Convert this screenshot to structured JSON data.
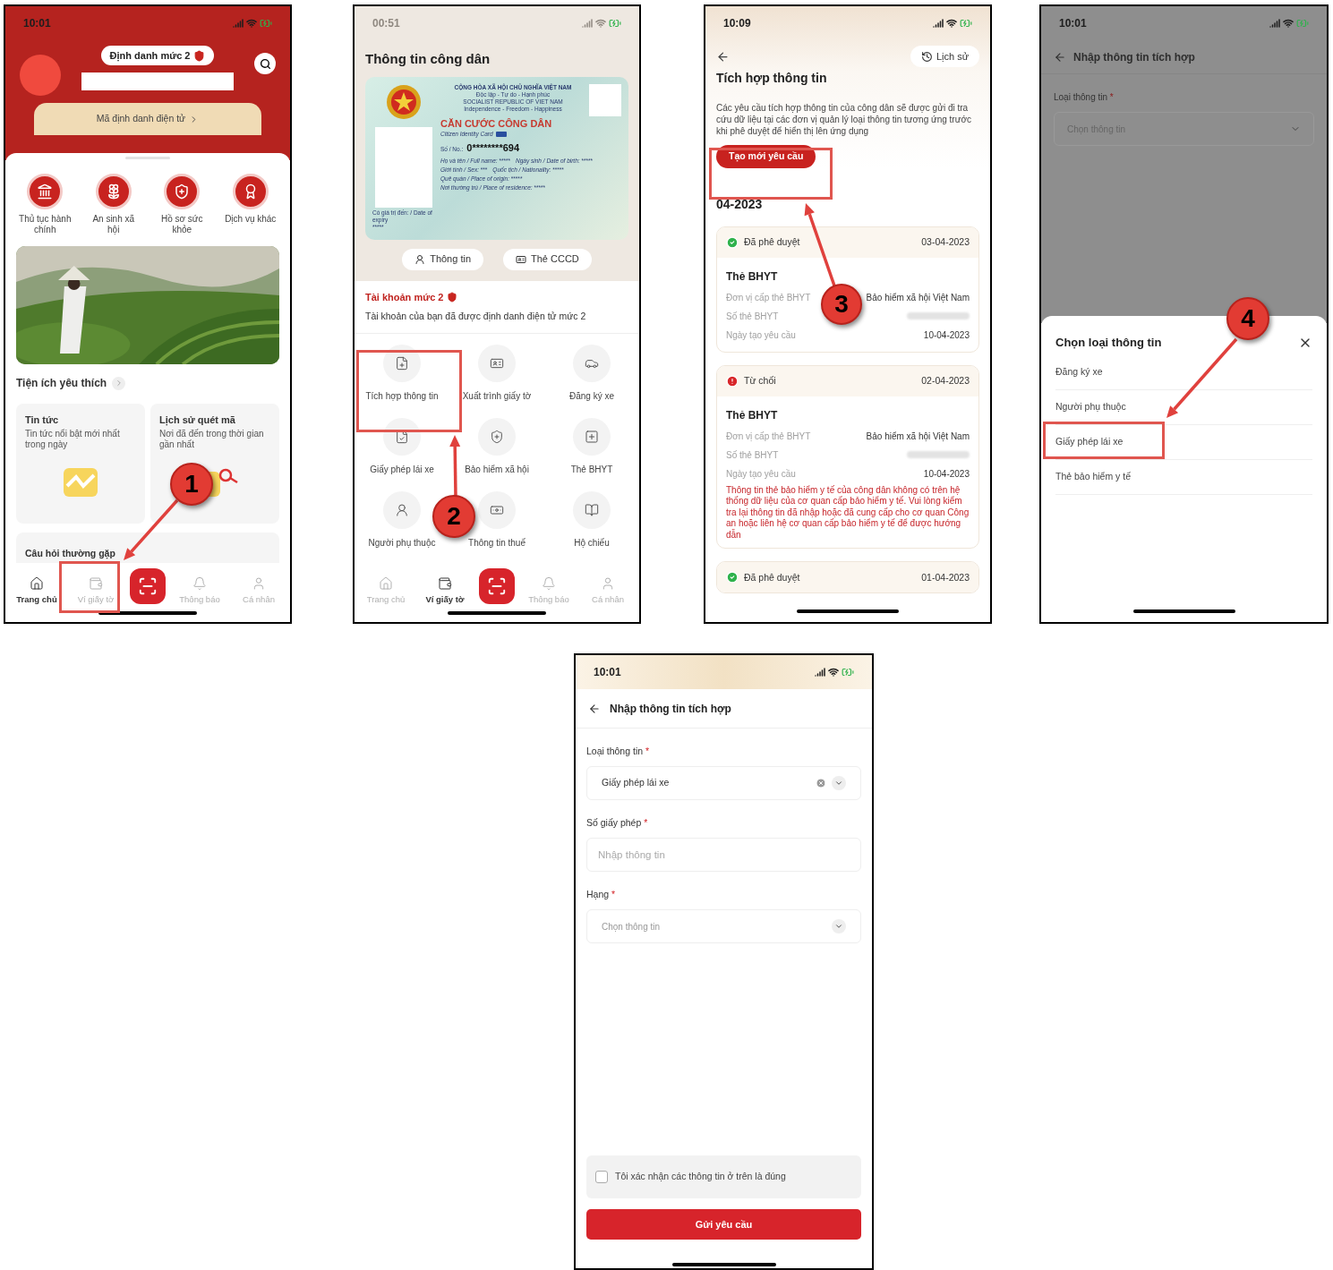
{
  "home_screen": {
    "time": "10:01",
    "level_badge": "Định danh mức 2",
    "id_link": "Mã định danh điện tử",
    "services": [
      "Thủ tục hành chính",
      "An sinh xã hội",
      "Hồ sơ sức khỏe",
      "Dịch vụ khác"
    ],
    "favorites_title": "Tiện ích yêu thích",
    "favorites": [
      {
        "title": "Tin tức",
        "description": "Tin tức nổi bật mới nhất trong ngày"
      },
      {
        "title": "Lịch sử quét mã",
        "description": "Nơi đã đến trong thời gian gần nhất"
      }
    ],
    "faq_title": "Câu hỏi thường gặp",
    "nav": [
      {
        "label": "Trang chủ",
        "selected": true
      },
      {
        "label": "Ví giấy tờ",
        "selected": false
      },
      {
        "label": "Thông báo",
        "selected": false
      },
      {
        "label": "Cá nhân",
        "selected": false
      }
    ],
    "step": "1"
  },
  "wallet_screen": {
    "time": "00:51",
    "title": "Thông tin công dân",
    "card": {
      "heading": "CỘNG HÒA XÃ HỘI CHỦ NGHĨA VIỆT NAM",
      "motto": "Độc lập - Tự do - Hạnh phúc",
      "heading_en": "SOCIALIST REPUBLIC OF VIET NAM",
      "motto_en": "Independence - Freedom - Happiness",
      "title": "CĂN CƯỚC CÔNG DÂN",
      "subtitle": "Citizen Identity Card",
      "number_label": "Số / No.:",
      "number": "0********694",
      "expiry_label": "Có giá trị đến: / Date of expiry",
      "expiry_value": "*****",
      "fields": [
        {
          "label": "Họ và tên / Full name:",
          "value": "*****"
        },
        {
          "label": "Ngày sinh / Date of birth:",
          "value": "*****"
        },
        {
          "label": "Giới tính / Sex:",
          "value": "***"
        },
        {
          "label": "Quốc tịch / Nationality:",
          "value": "*****"
        },
        {
          "label": "Quê quán / Place of origin:",
          "value": "*****"
        },
        {
          "label": "Nơi thường trú / Place of residence:",
          "value": "*****"
        }
      ]
    },
    "card_buttons": [
      "Thông tin",
      "Thẻ CCCD"
    ],
    "account_level": "Tài khoản mức 2",
    "account_note": "Tài khoản của bạn đã được định danh điện tử mức 2",
    "features": [
      "Tích hợp thông tin",
      "Xuất trình giấy tờ",
      "Đăng ký xe",
      "Giấy phép lái xe",
      "Bảo hiểm xã hội",
      "Thẻ BHYT",
      "Người phụ thuộc",
      "Thông tin thuế",
      "Hộ chiếu"
    ],
    "nav": [
      {
        "label": "Trang chủ",
        "selected": false
      },
      {
        "label": "Ví giấy tờ",
        "selected": true
      },
      {
        "label": "Thông báo",
        "selected": false
      },
      {
        "label": "Cá nhân",
        "selected": false
      }
    ],
    "step": "2"
  },
  "integration_screen": {
    "time": "10:09",
    "history_button": "Lịch sử",
    "title": "Tích hợp thông tin",
    "description": "Các yêu cầu tích hợp thông tin của công dân sẽ được gửi đi tra cứu dữ liệu tại các đơn vị quản lý loại thông tin tương ứng trước khi phê duyệt để hiển thị lên ứng dụng",
    "create_button": "Tạo mới yêu cầu",
    "month": "04-2023",
    "requests": [
      {
        "kind": "approved",
        "status_label": "Đã phê duyệt",
        "date": "03-04-2023",
        "title": "Thẻ BHYT",
        "rows": [
          {
            "label": "Đơn vị cấp thẻ BHYT",
            "value": "Bảo hiểm xã hội Việt Nam"
          },
          {
            "label": "Số thẻ BHYT",
            "redacted": true
          },
          {
            "label": "Ngày tạo yêu cầu",
            "value": "10-04-2023"
          }
        ]
      },
      {
        "kind": "rejected",
        "status_label": "Từ chối",
        "date": "02-04-2023",
        "title": "Thẻ BHYT",
        "rows": [
          {
            "label": "Đơn vị cấp thẻ BHYT",
            "value": "Bảo hiểm xã hội Việt Nam"
          },
          {
            "label": "Số thẻ BHYT",
            "redacted": true
          },
          {
            "label": "Ngày tạo yêu cầu",
            "value": "10-04-2023"
          }
        ],
        "message": "Thông tin thẻ bảo hiểm y tế của công dân không có trên hệ thống dữ liệu của cơ quan cấp bảo hiểm y tế. Vui lòng kiểm tra lại thông tin đã nhập hoặc đã cung cấp cho cơ quan Công an hoặc liên hệ cơ quan cấp bảo hiểm y tế để được hướng dẫn"
      },
      {
        "kind": "approved",
        "status_label": "Đã phê duyệt",
        "date": "01-04-2023"
      }
    ],
    "step": "3"
  },
  "picker_screen": {
    "time": "10:01",
    "title": "Nhập thông tin tích hợp",
    "field_label": "Loại thông tin",
    "field_required_mark": "*",
    "placeholder": "Chọn thông tin",
    "sheet_title": "Chọn loại thông tin",
    "options": [
      "Đăng ký xe",
      "Người phụ thuộc",
      "Giấy phép lái xe",
      "Thẻ bảo hiểm y tế"
    ],
    "step": "4"
  },
  "form_screen": {
    "time": "10:01",
    "title": "Nhập thông tin tích hợp",
    "fields": [
      {
        "kind": "select",
        "label": "Loại thông tin",
        "required_mark": "*",
        "value": "Giấy phép lái xe"
      },
      {
        "kind": "text",
        "label": "Số giấy phép",
        "required_mark": "*",
        "placeholder": "Nhập thông tin"
      },
      {
        "kind": "select",
        "label": "Hạng",
        "required_mark": "*",
        "placeholder": "Chọn thông tin"
      }
    ],
    "confirmation": {
      "label": "Tôi xác nhận các thông tin ở trên là đúng",
      "checked": false
    },
    "submit": "Gửi yêu cầu"
  }
}
